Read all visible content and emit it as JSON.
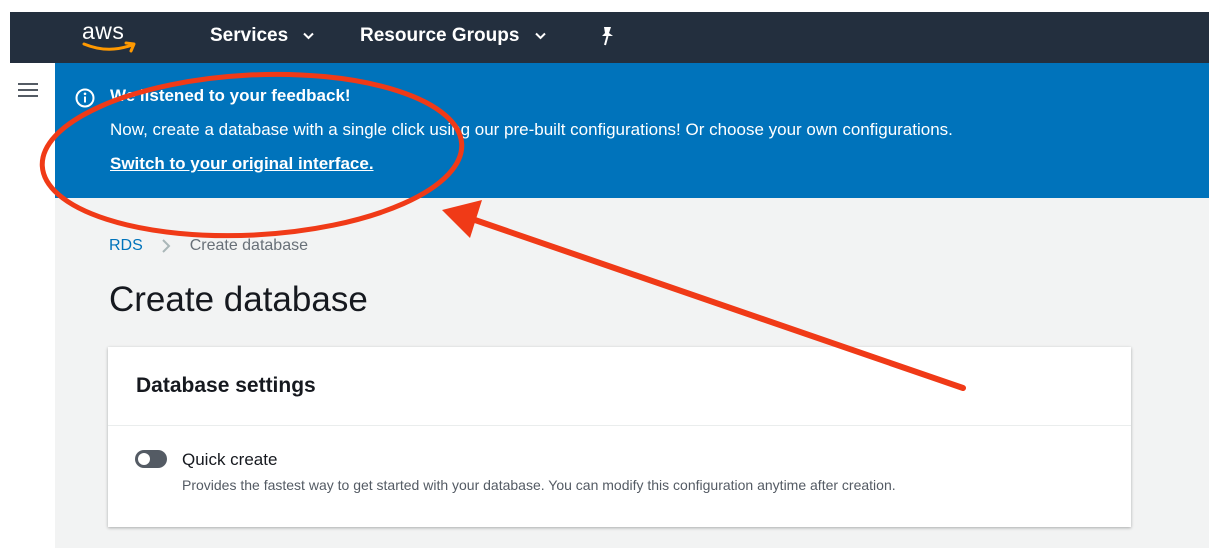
{
  "topnav": {
    "logo_text": "aws",
    "services_label": "Services",
    "resource_groups_label": "Resource Groups"
  },
  "banner": {
    "title": "We listened to your feedback!",
    "message": "Now, create a database with a single click using our pre-built configurations! Or choose your own configurations.",
    "link_text": "Switch to your original interface."
  },
  "breadcrumb": {
    "root": "RDS",
    "current": "Create database"
  },
  "page": {
    "title": "Create database"
  },
  "settings": {
    "title": "Database settings",
    "quick_create": {
      "label": "Quick create",
      "description": "Provides the fastest way to get started with your database. You can modify this configuration anytime after creation.",
      "enabled": false
    }
  },
  "colors": {
    "nav_bg": "#232f3e",
    "banner_bg": "#0073bb",
    "link_blue": "#0073bb",
    "aws_orange": "#ff9900",
    "annotation_red": "#f03a17"
  },
  "icons": [
    "aws-smile-icon",
    "chevron-down-icon",
    "pin-icon",
    "hamburger-menu-icon",
    "info-icon",
    "chevron-right-icon"
  ]
}
